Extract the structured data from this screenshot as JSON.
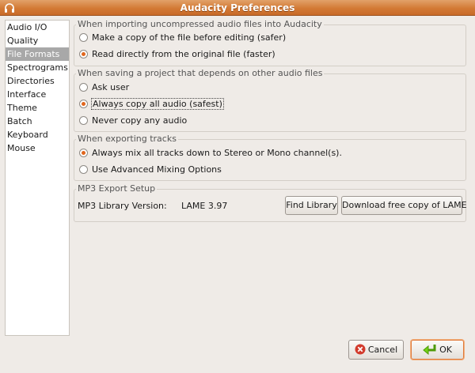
{
  "window": {
    "title": "Audacity Preferences"
  },
  "sidebar": {
    "items": [
      {
        "label": "Audio I/O"
      },
      {
        "label": "Quality"
      },
      {
        "label": "File Formats",
        "selected": true
      },
      {
        "label": "Spectrograms"
      },
      {
        "label": "Directories"
      },
      {
        "label": "Interface"
      },
      {
        "label": "Theme"
      },
      {
        "label": "Batch"
      },
      {
        "label": "Keyboard"
      },
      {
        "label": "Mouse"
      }
    ]
  },
  "import_group": {
    "title": "When importing uncompressed audio files into Audacity",
    "options": [
      {
        "label": "Make a copy of the file before editing (safer)",
        "checked": false
      },
      {
        "label": "Read directly from the original file (faster)",
        "checked": true
      }
    ]
  },
  "save_group": {
    "title": "When saving a project that depends on other audio files",
    "options": [
      {
        "label": "Ask user",
        "checked": false
      },
      {
        "label": "Always copy all audio (safest)",
        "checked": true
      },
      {
        "label": "Never copy any audio",
        "checked": false
      }
    ]
  },
  "export_group": {
    "title": "When exporting tracks",
    "options": [
      {
        "label": "Always mix all tracks down to Stereo or Mono channel(s).",
        "checked": true
      },
      {
        "label": "Use Advanced Mixing Options",
        "checked": false
      }
    ]
  },
  "mp3_group": {
    "title": "MP3 Export Setup",
    "library_label": "MP3 Library Version:",
    "library_version": "LAME 3.97",
    "find_button": "Find Library",
    "download_button": "Download free copy of LAME"
  },
  "footer": {
    "cancel_label": "Cancel",
    "ok_label": "OK"
  },
  "colors": {
    "titlebar": "#d37a35",
    "radio_dot": "#e0661d",
    "selected_item": "#a8a8a8"
  }
}
